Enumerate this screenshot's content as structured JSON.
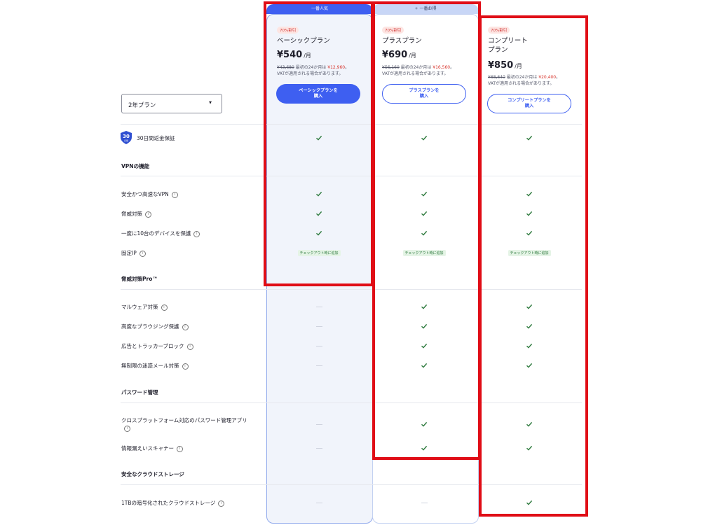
{
  "plans": {
    "basic": {
      "header": "一番人気",
      "discount": "70%割引",
      "name": "ベーシックプラン",
      "price": "¥540",
      "per": "/月",
      "old_price": "¥43,680",
      "first_label": "最初の24か月は",
      "first_price": "¥12,960",
      "vat_note": "VATが適用される場合があります。",
      "button": "ベーシックプランを\n購入"
    },
    "plus": {
      "header": "一番お得",
      "discount": "70%割引",
      "name": "プラスプラン",
      "price": "¥690",
      "per": "/月",
      "old_price": "¥56,160",
      "first_label": "最初の24か月は",
      "first_price": "¥16,560",
      "vat_note": "VATが適用される場合があります。",
      "button": "プラスプランを\n購入"
    },
    "complete": {
      "discount": "70%割引",
      "name": "コンプリート\nプラン",
      "price": "¥850",
      "per": "/月",
      "old_price": "¥68,640",
      "first_label": "最初の24か月は",
      "first_price": "¥20,400",
      "vat_note": "VATが適用される場合があります。",
      "button": "コンプリートプランを\n購入"
    }
  },
  "term_select": {
    "value": "2年プラン"
  },
  "guarantee": {
    "badge": "30",
    "badge_sub": "日間",
    "label": "30日間返金保証"
  },
  "sections": {
    "vpn": "VPNの機能",
    "threat": "脅威対策Pro™",
    "password": "パスワード管理",
    "storage": "安全なクラウドストレージ"
  },
  "features": {
    "fast_vpn": "安全かつ高速なVPN",
    "threat_protect": "脅威対策",
    "devices": "一度に10台のデバイスを保護",
    "static_ip": "固定IP",
    "malware": "マルウェア対策",
    "browsing": "高度なブラウジング保護",
    "ads": "広告とトラッカーブロック",
    "email": "無制限の迷惑メール対策",
    "password_app": "クロスプラットフォーム対応のパスワード管理アプリ",
    "leak": "情報漏えいスキャナー",
    "cloud": "1TBの暗号化されたクラウドストレージ"
  },
  "addon_label": "チェックアウト時に追加",
  "colors": {
    "accent": "#3e5ff1",
    "check": "#2f7b3f",
    "highlight": "#e00d16"
  }
}
